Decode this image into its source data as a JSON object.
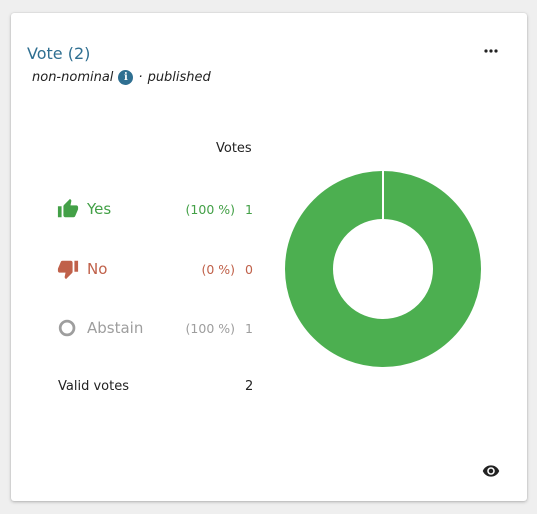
{
  "card": {
    "title": "Vote (2)",
    "subtitle_type": "non-nominal",
    "subtitle_separator": "·",
    "subtitle_state": "published"
  },
  "table": {
    "votes_header": "Votes",
    "rows": [
      {
        "label": "Yes",
        "percent": "(100 %)",
        "count": "1",
        "icon": "thumb-up-icon",
        "color": "#43a047"
      },
      {
        "label": "No",
        "percent": "(0 %)",
        "count": "0",
        "icon": "thumb-down-icon",
        "color": "#c0614a"
      },
      {
        "label": "Abstain",
        "percent": "(100 %)",
        "count": "1",
        "icon": "circle-outline-icon",
        "color": "#9e9e9e"
      }
    ],
    "valid_label": "Valid votes",
    "valid_count": "2"
  },
  "chart_data": {
    "type": "pie",
    "donut": true,
    "categories": [
      "Yes",
      "No"
    ],
    "values": [
      1,
      0
    ],
    "colors": [
      "#4caf50",
      "#c0614a"
    ]
  },
  "icons": {
    "menu": "more-horizontal-icon",
    "info": "info-icon",
    "visibility": "eye-icon"
  }
}
